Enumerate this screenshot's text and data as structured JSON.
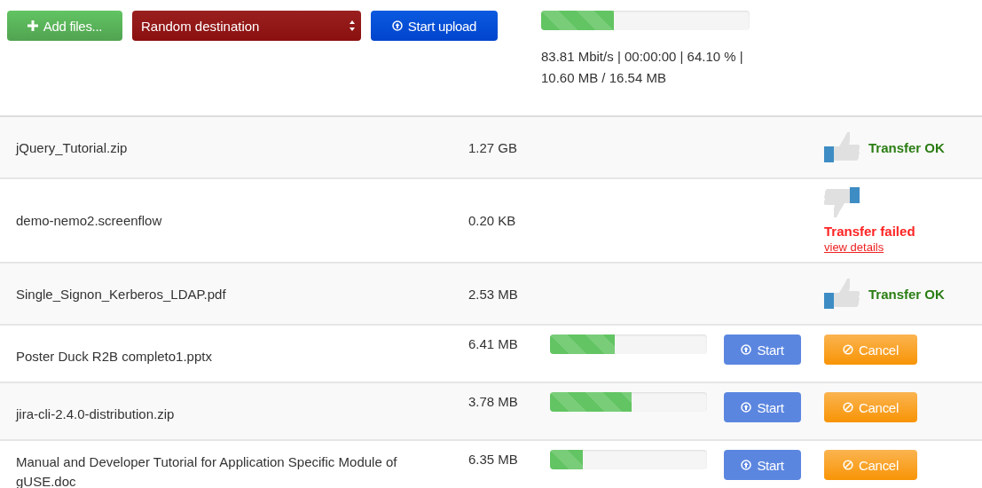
{
  "toolbar": {
    "add_button": "Add files...",
    "destination": "Random destination",
    "start_button": "Start upload"
  },
  "overall": {
    "level": 0.35,
    "stats": "83.81 Mbit/s | 00:00:00 | 64.10 % | 10.60 MB / 16.54 MB"
  },
  "files": [
    {
      "kind": "ok",
      "name": "jQuery_Tutorial.zip",
      "size": "1.27 GB",
      "status": "Transfer OK"
    },
    {
      "kind": "failed",
      "name": "demo-nemo2.screenflow",
      "size": "0.20 KB",
      "status": "Transfer failed",
      "link": "view details"
    },
    {
      "kind": "ok",
      "name": "Single_Signon_Kerberos_LDAP.pdf",
      "size": "2.53 MB",
      "status": "Transfer OK"
    },
    {
      "kind": "uploading",
      "name": "Poster Duck R2B completo1.pptx",
      "size": "6.41 MB",
      "level": 0.41,
      "start": "Start",
      "cancel": "Cancel"
    },
    {
      "kind": "uploading",
      "name": "jira-cli-2.4.0-distribution.zip",
      "size": "3.78 MB",
      "level": 0.52,
      "start": "Start",
      "cancel": "Cancel"
    },
    {
      "kind": "uploading",
      "name": "Manual and Developer Tutorial for Application Specific Module of gUSE.doc",
      "size": "6.35 MB",
      "level": 0.21,
      "start": "Start",
      "cancel": "Cancel"
    }
  ]
}
